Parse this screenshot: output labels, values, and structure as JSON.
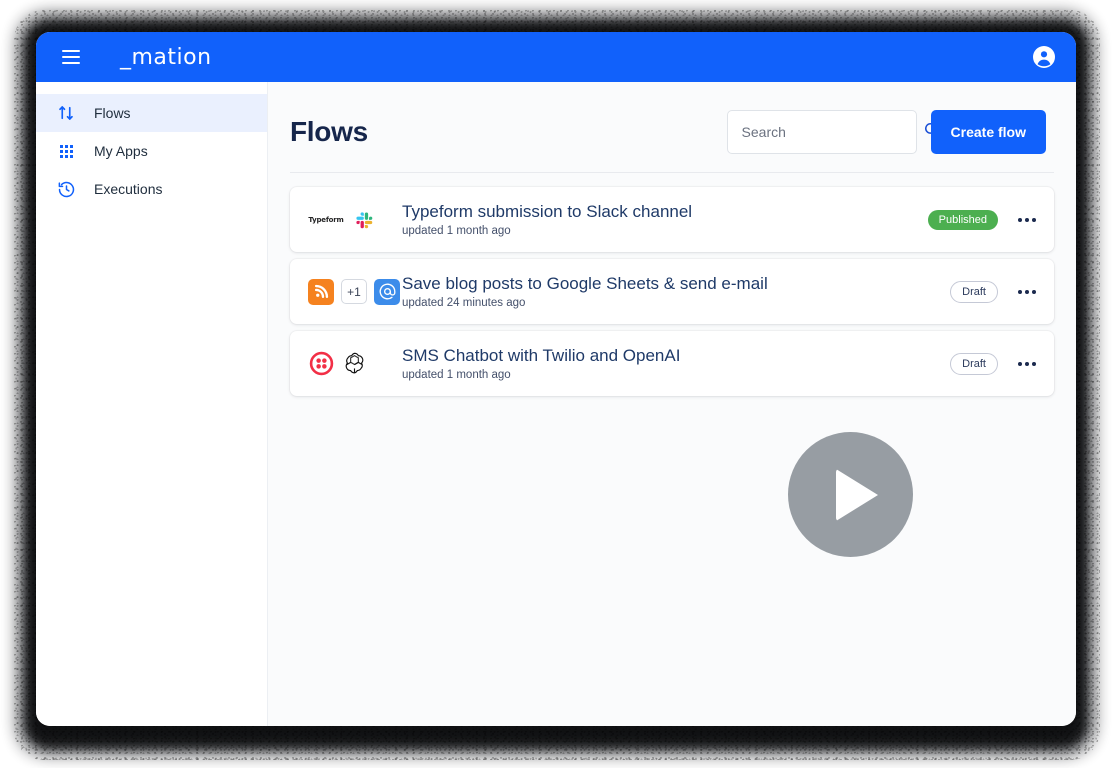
{
  "topbar": {
    "menu_icon": "hamburger-icon",
    "logo_text": "_mation",
    "account_icon": "account-circle-icon",
    "brand_color": "#1161fb"
  },
  "sidebar": {
    "items": [
      {
        "label": "Flows",
        "icon": "swap-vertical-icon",
        "active": true
      },
      {
        "label": "My Apps",
        "icon": "apps-grid-icon",
        "active": false
      },
      {
        "label": "Executions",
        "icon": "history-clock-icon",
        "active": false
      }
    ]
  },
  "header": {
    "title": "Flows",
    "search": {
      "placeholder": "Search",
      "value": "",
      "icon": "search-icon"
    },
    "create_button": {
      "label": "Create flow"
    }
  },
  "flows": [
    {
      "name": "Typeform submission to Slack channel",
      "meta": "updated 1 month ago",
      "status": "Published",
      "status_kind": "published",
      "apps": [
        {
          "icon": "typeform-icon",
          "label": "Typeform"
        },
        {
          "icon": "slack-icon",
          "label": "Slack"
        }
      ],
      "menu_icon": "more-options-icon"
    },
    {
      "name": "Save blog posts to Google Sheets & send e-mail",
      "meta": "updated 24 minutes ago",
      "status": "Draft",
      "status_kind": "draft",
      "apps": [
        {
          "icon": "rss-icon",
          "label": "RSS"
        },
        {
          "icon": "more-count-chip",
          "label": "+1"
        },
        {
          "icon": "email-at-icon",
          "label": "E-mail"
        }
      ],
      "menu_icon": "more-options-icon"
    },
    {
      "name": "SMS Chatbot with Twilio and OpenAI",
      "meta": "updated 1 month ago",
      "status": "Draft",
      "status_kind": "draft",
      "apps": [
        {
          "icon": "twilio-icon",
          "label": "Twilio"
        },
        {
          "icon": "openai-icon",
          "label": "OpenAI"
        }
      ],
      "menu_icon": "more-options-icon"
    }
  ],
  "overlay": {
    "play_icon": "play-button-icon"
  },
  "colors": {
    "brand_blue": "#1161fb",
    "title_navy": "#16264b",
    "published_green": "#4caf50",
    "rss_orange": "#f5821f",
    "twilio_red": "#f22f46"
  }
}
